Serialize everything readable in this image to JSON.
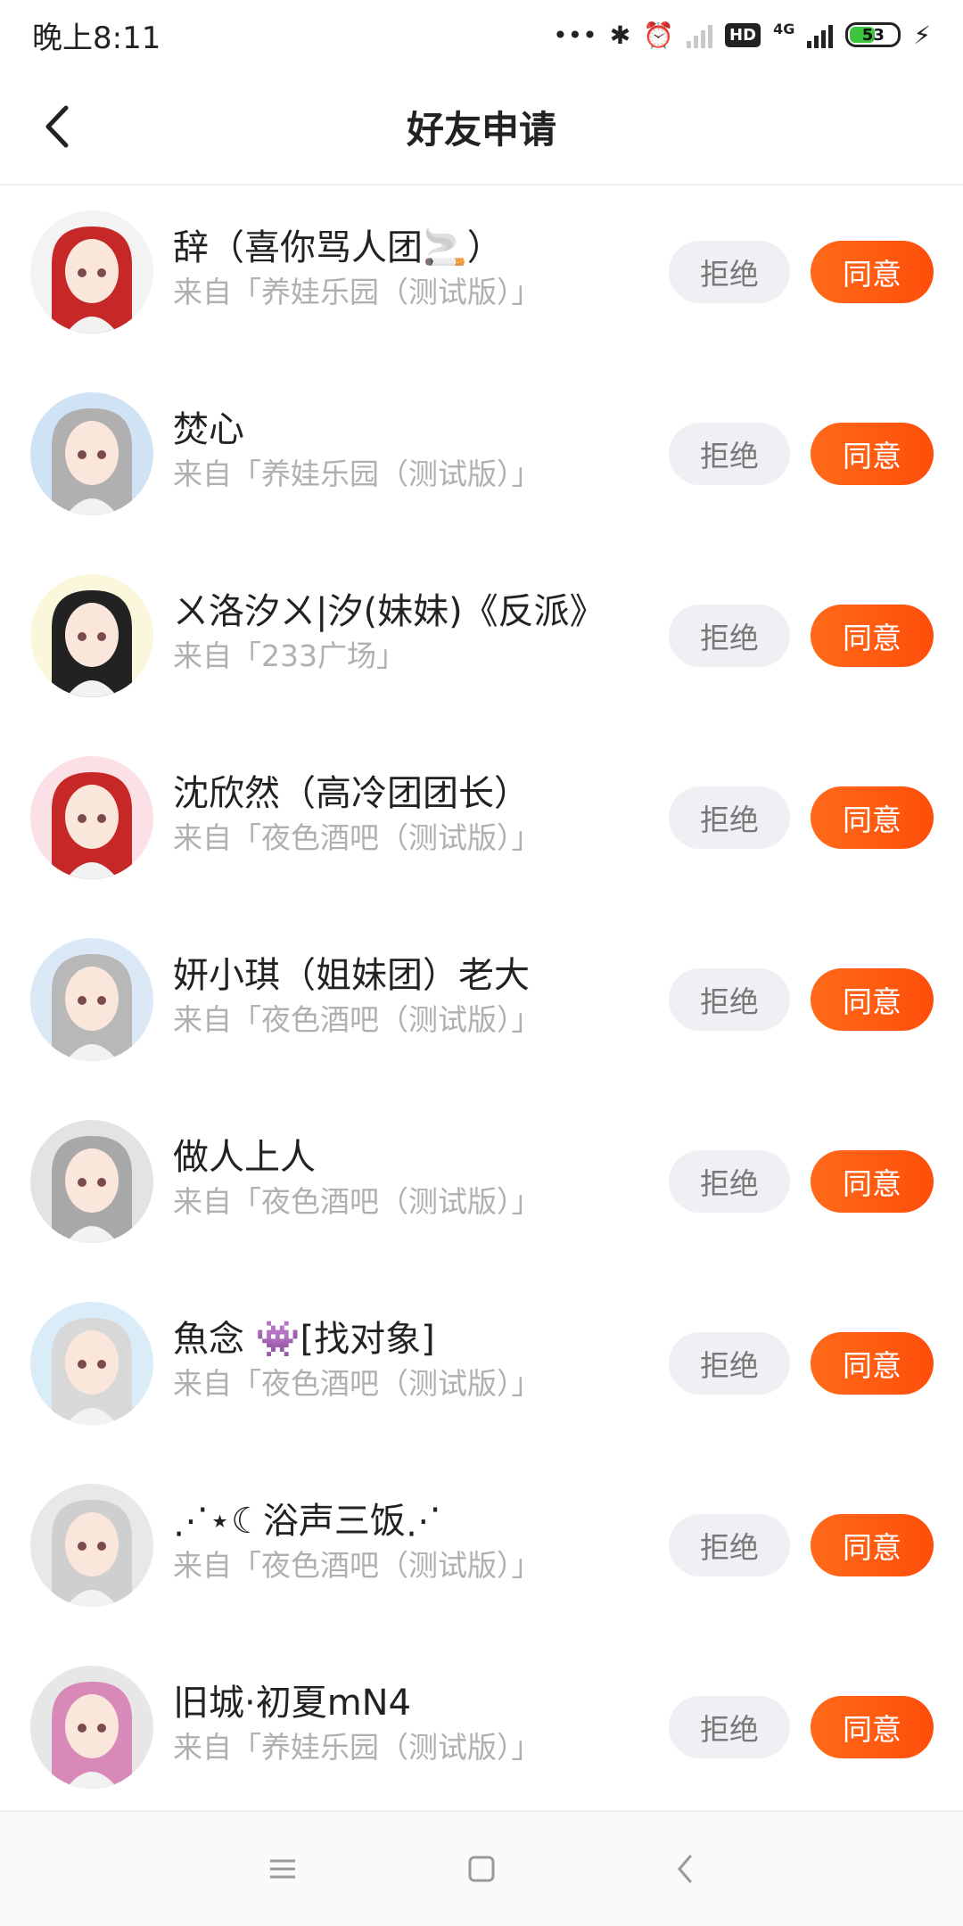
{
  "status_bar": {
    "time": "晚上8:11",
    "network": "4G",
    "hd_badge": "HD",
    "battery_level": "53"
  },
  "header": {
    "title": "好友申请"
  },
  "buttons": {
    "reject_label": "拒绝",
    "accept_label": "同意"
  },
  "requests": [
    {
      "name": "辞（喜你骂人团🚬）",
      "source": "来自「养娃乐园（测试版）」",
      "avatar_color": "#c62828",
      "avatar_bg": "#f3f3f3"
    },
    {
      "name": "焚心",
      "source": "来自「养娃乐园（测试版）」",
      "avatar_color": "#b0b0b0",
      "avatar_bg": "#cfe3f5"
    },
    {
      "name": "ㄨ洛汐ㄨ|汐(妹妹)《反派》",
      "source": "来自「233广场」",
      "avatar_color": "#222222",
      "avatar_bg": "#fbf7dd"
    },
    {
      "name": "沈欣然（高冷团团长）",
      "source": "来自「夜色酒吧（测试版）」",
      "avatar_color": "#c62828",
      "avatar_bg": "#fbe0e6"
    },
    {
      "name": "妍小琪（姐妹团）老大",
      "source": "来自「夜色酒吧（测试版）」",
      "avatar_color": "#b8b8b8",
      "avatar_bg": "#dbe9f7"
    },
    {
      "name": "做人上人",
      "source": "来自「夜色酒吧（测试版）」",
      "avatar_color": "#a8a8a8",
      "avatar_bg": "#e3e3e3"
    },
    {
      "name": "魚念 👾[找对象]",
      "source": "来自「夜色酒吧（测试版）」",
      "avatar_color": "#d8d8d8",
      "avatar_bg": "#d9ecf7"
    },
    {
      "name": "⋰⋆☾浴声三饭⋰",
      "source": "来自「夜色酒吧（测试版）」",
      "avatar_color": "#cfcfcf",
      "avatar_bg": "#e8e8e8"
    },
    {
      "name": "旧城·初夏mN4",
      "source": "来自「养娃乐园（测试版）」",
      "avatar_color": "#d889b8",
      "avatar_bg": "#e7e7e7"
    }
  ]
}
